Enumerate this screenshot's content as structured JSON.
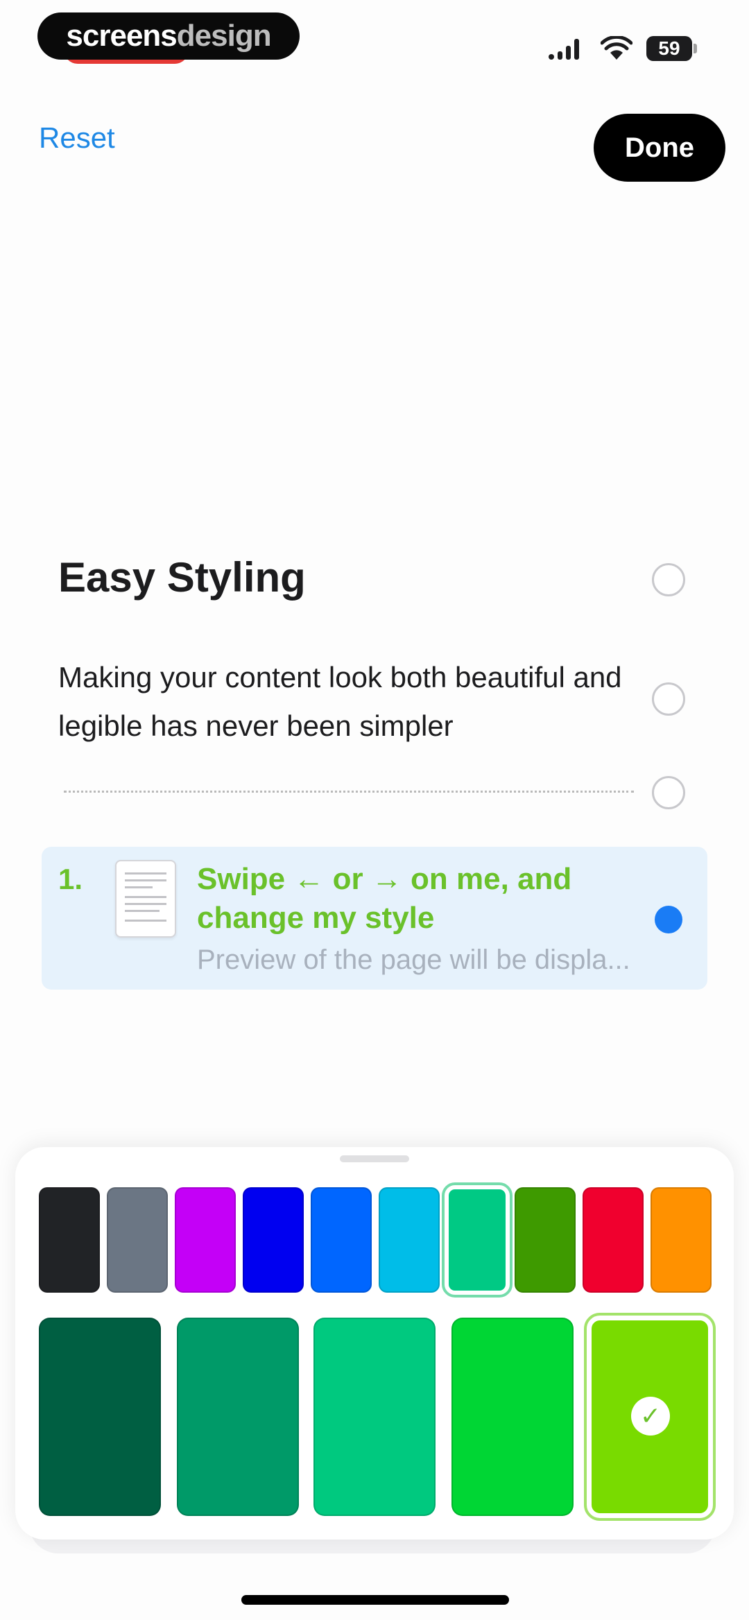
{
  "status_bar": {
    "watermark_brand": "screens",
    "watermark_suffix": "design",
    "battery": "59"
  },
  "nav": {
    "reset_label": "Reset",
    "done_label": "Done"
  },
  "content": {
    "heading": "Easy Styling",
    "paragraph": "Making your content look both beautiful and legible has never been simpler",
    "list_item": {
      "number": "1.",
      "title": "Swipe ← or → on me, and change my style",
      "subtitle": "Preview of the page will be displa..."
    }
  },
  "palette": {
    "primary_colors": [
      {
        "name": "black",
        "hex": "#212326"
      },
      {
        "name": "gray",
        "hex": "#6b7684"
      },
      {
        "name": "magenta",
        "hex": "#c400f7"
      },
      {
        "name": "blue",
        "hex": "#0000f0"
      },
      {
        "name": "azure",
        "hex": "#0066ff"
      },
      {
        "name": "sky",
        "hex": "#00bde8"
      },
      {
        "name": "mint",
        "hex": "#00c984",
        "selected": true
      },
      {
        "name": "green",
        "hex": "#3e9a00"
      },
      {
        "name": "red",
        "hex": "#f0002e"
      },
      {
        "name": "orange",
        "hex": "#ff9100"
      }
    ],
    "shades": [
      {
        "hex": "#005f42"
      },
      {
        "hex": "#009a68"
      },
      {
        "hex": "#00c97f"
      },
      {
        "hex": "#00d634"
      },
      {
        "hex": "#79db00",
        "selected": true
      }
    ],
    "accent_text": "#6ac12a",
    "link_color": "#1e88e5"
  },
  "icons": {
    "check": "✓"
  }
}
